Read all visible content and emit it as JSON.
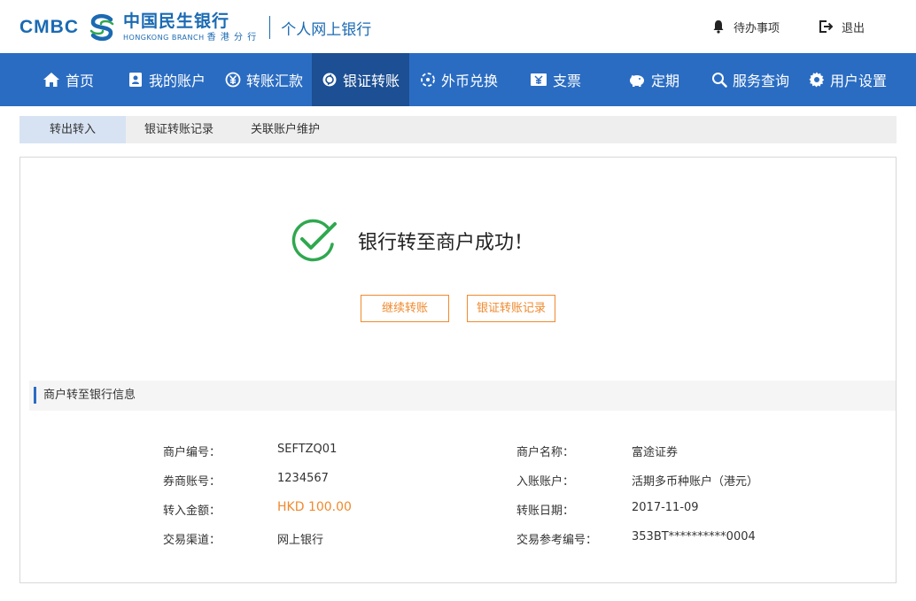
{
  "brand": {
    "logo_letters": "CMBC",
    "bank_name": "中国民生银行",
    "branch_en": "HONGKONG BRANCH",
    "branch_cn": "香 港 分 行",
    "product": "个人网上银行"
  },
  "header": {
    "todo": "待办事项",
    "logout": "退出"
  },
  "nav": {
    "items": [
      {
        "label": "首页",
        "icon": "home-icon"
      },
      {
        "label": "我的账户",
        "icon": "account-book-icon"
      },
      {
        "label": "转账汇款",
        "icon": "yen-circle-icon"
      },
      {
        "label": "银证转账",
        "icon": "exchange-circle-icon"
      },
      {
        "label": "外币兑换",
        "icon": "currency-exchange-icon"
      },
      {
        "label": "支票",
        "icon": "cheque-icon"
      },
      {
        "label": "定期",
        "icon": "piggy-bank-icon"
      },
      {
        "label": "服务查询",
        "icon": "search-icon"
      },
      {
        "label": "用户设置",
        "icon": "gear-icon"
      }
    ],
    "active_index": 3
  },
  "subtabs": {
    "items": [
      "转出转入",
      "银证转账记录",
      "关联账户维护"
    ],
    "active_index": 0
  },
  "result": {
    "title": "银行转至商户成功！",
    "continue_button": "继续转账",
    "record_button": "银证转账记录"
  },
  "section": {
    "title": "商户转至银行信息"
  },
  "details": {
    "merchant_no_label": "商户编号：",
    "merchant_no": "SEFTZQ01",
    "merchant_name_label": "商户名称：",
    "merchant_name": "富途证券",
    "broker_account_label": "券商账号：",
    "broker_account": "1234567",
    "credit_account_label": "入账账户：",
    "credit_account": "活期多币种账户（港元）",
    "amount_label": "转入金额：",
    "amount": "HKD 100.00",
    "transfer_date_label": "转账日期：",
    "transfer_date": "2017-11-09",
    "channel_label": "交易渠道：",
    "channel": "网上银行",
    "reference_label": "交易参考编号：",
    "reference": "353BT**********0004"
  },
  "colors": {
    "brand_blue": "#1a6ab3",
    "nav_blue": "#2a6cc2",
    "nav_active": "#1c4f93",
    "accent_orange": "#ef8a2e",
    "success_green": "#2fa84f"
  }
}
